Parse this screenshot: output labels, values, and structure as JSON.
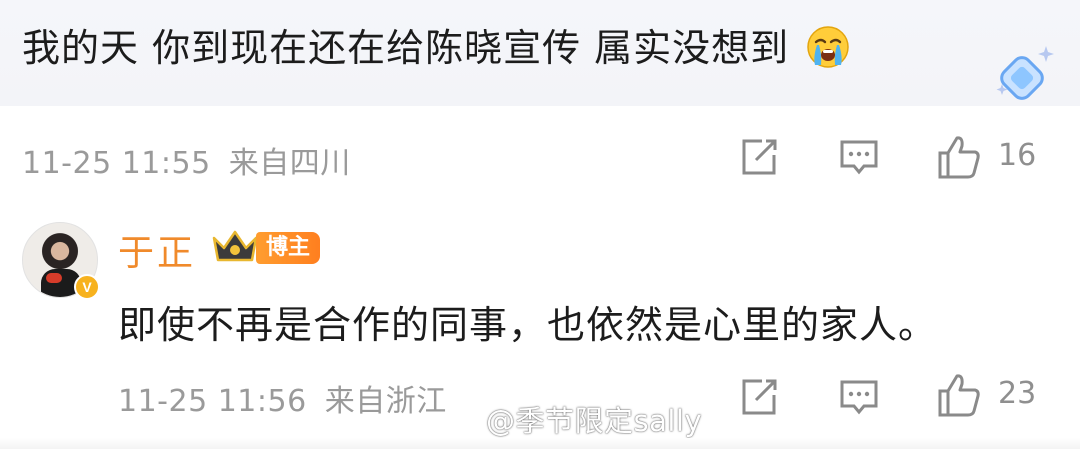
{
  "comment": {
    "text": "我的天 你到现在还在给陈晓宣传 属实没想到",
    "emoji": "crying-face-icon",
    "time": "11-25 11:55",
    "location": "来自四川",
    "likes": "16"
  },
  "reply": {
    "username": "于正",
    "badge_label": "博主",
    "text": "即使不再是合作的同事，也依然是心里的家人。",
    "time": "11-25 11:56",
    "location": "来自浙江",
    "likes": "23"
  },
  "watermark": {
    "text": "@季节限定sally"
  },
  "colors": {
    "username": "#f08a2b",
    "badge": "#ff8a24",
    "meta": "#9a9a9a",
    "verified": "#f7b21e"
  }
}
